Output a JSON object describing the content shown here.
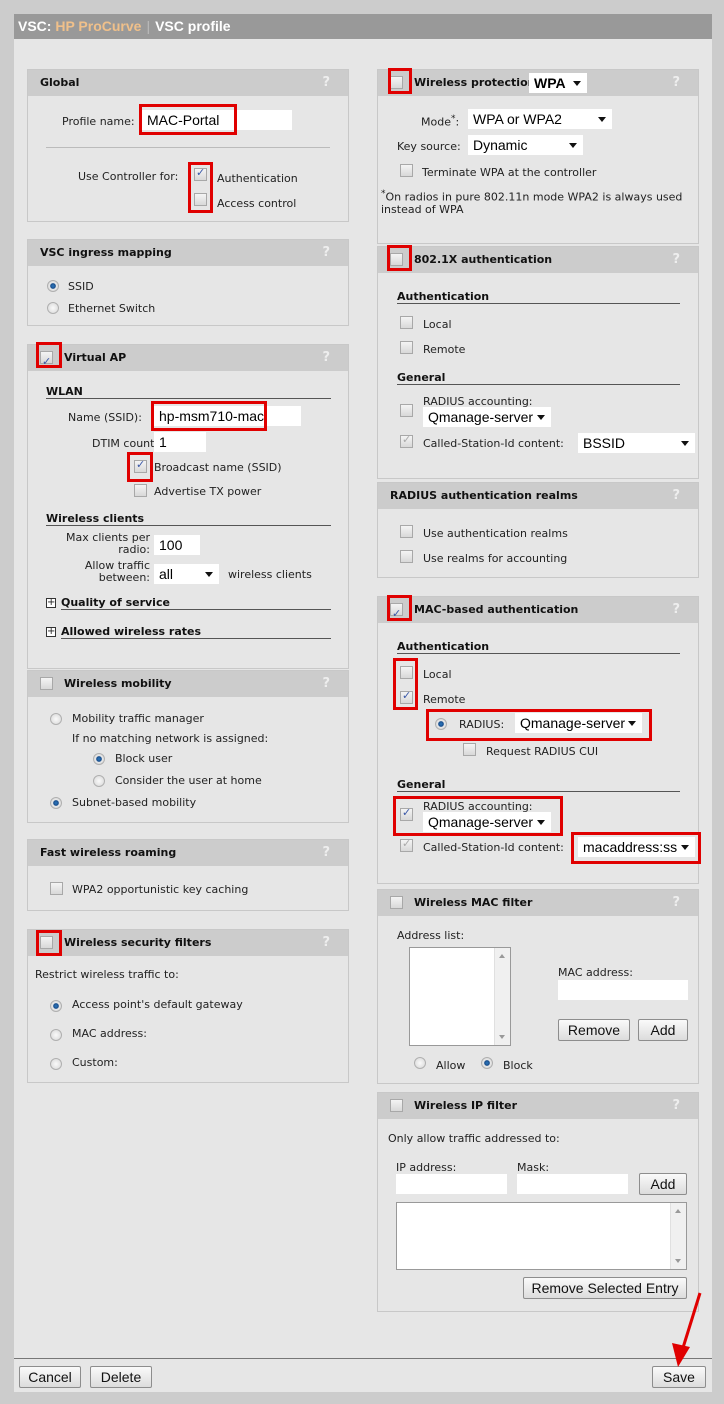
{
  "title": {
    "prefix": "VSC:",
    "brand": "HP ProCurve",
    "separator": "|",
    "page": "VSC profile"
  },
  "global": {
    "header": "Global",
    "help": "?",
    "profile_name_label": "Profile name:",
    "profile_name_value": "MAC-Portal",
    "use_controller_label": "Use Controller for:",
    "authentication_label": "Authentication",
    "authentication_checked": true,
    "access_control_label": "Access control",
    "access_control_checked": false
  },
  "ingress": {
    "header": "VSC ingress mapping",
    "help": "?",
    "options": [
      "SSID",
      "Ethernet Switch"
    ],
    "selected": "SSID"
  },
  "virtual_ap": {
    "header": "Virtual AP",
    "help": "?",
    "enabled": true,
    "wlan_section": "WLAN",
    "ssid_label": "Name (SSID):",
    "ssid_value": "hp-msm710-mac",
    "dtim_label": "DTIM count:",
    "dtim_value": "1",
    "broadcast_label": "Broadcast name (SSID)",
    "broadcast_checked": true,
    "advertise_label": "Advertise TX power",
    "advertise_checked": false,
    "clients_section": "Wireless clients",
    "max_clients_label_1": "Max clients per",
    "max_clients_label_2": "radio:",
    "max_clients_value": "100",
    "allow_traffic_label_1": "Allow traffic",
    "allow_traffic_label_2": "between:",
    "allow_traffic_value": "all",
    "allow_traffic_suffix": "wireless clients",
    "qos_label": "Quality of service",
    "rates_label": "Allowed wireless rates",
    "expand_symbol": "+"
  },
  "mobility": {
    "header": "Wireless mobility",
    "help": "?",
    "enabled": false,
    "traffic_manager_label": "Mobility traffic manager",
    "no_match_label": "If no matching network is assigned:",
    "block_user_label": "Block user",
    "consider_home_label": "Consider the user at home",
    "subnet_label": "Subnet-based mobility"
  },
  "roaming": {
    "header": "Fast wireless roaming",
    "help": "?",
    "okc_label": "WPA2 opportunistic key caching",
    "okc_checked": false
  },
  "security_filters": {
    "header": "Wireless security filters",
    "help": "?",
    "enabled": false,
    "restrict_label": "Restrict wireless traffic to:",
    "options": [
      "Access point's default gateway",
      "MAC address:",
      "Custom:"
    ],
    "selected": "Access point's default gateway"
  },
  "protection": {
    "header": "Wireless protection",
    "help": "?",
    "enabled": false,
    "type_value": "WPA",
    "mode_label": "Mode",
    "mode_asterisk": "*",
    "mode_colon": ":",
    "mode_value": "WPA or WPA2",
    "key_source_label": "Key source:",
    "key_source_value": "Dynamic",
    "terminate_label": "Terminate WPA at the controller",
    "terminate_checked": false,
    "note_asterisk": "*",
    "note": "On radios in pure 802.11n mode WPA2 is always used instead of WPA"
  },
  "dot1x": {
    "header": "802.1X authentication",
    "help": "?",
    "enabled": false,
    "auth_section": "Authentication",
    "local_label": "Local",
    "remote_label": "Remote",
    "general_section": "General",
    "radius_accounting_label": "RADIUS accounting:",
    "radius_accounting_value": "Qmanage-server",
    "called_station_label": "Called-Station-Id content:",
    "called_station_value": "BSSID"
  },
  "realms": {
    "header": "RADIUS authentication realms",
    "help": "?",
    "use_realms_label": "Use authentication realms",
    "realms_accounting_label": "Use realms for accounting"
  },
  "mac_auth": {
    "header": "MAC-based authentication",
    "help": "?",
    "enabled": true,
    "auth_section": "Authentication",
    "local_label": "Local",
    "local_checked": false,
    "remote_label": "Remote",
    "remote_checked": true,
    "radius_label": "RADIUS:",
    "radius_value": "Qmanage-server",
    "cui_label": "Request RADIUS CUI",
    "general_section": "General",
    "radius_accounting_label": "RADIUS accounting:",
    "radius_accounting_value": "Qmanage-server",
    "radius_accounting_checked": true,
    "called_station_label": "Called-Station-Id content:",
    "called_station_value": "macaddress:ss"
  },
  "mac_filter": {
    "header": "Wireless MAC filter",
    "help": "?",
    "enabled": false,
    "address_list_label": "Address list:",
    "mac_address_label": "MAC address:",
    "mac_address_value": "",
    "remove_label": "Remove",
    "add_label": "Add",
    "allow_label": "Allow",
    "block_label": "Block",
    "selected": "Block"
  },
  "ip_filter": {
    "header": "Wireless IP filter",
    "help": "?",
    "enabled": false,
    "only_allow_label": "Only allow traffic addressed to:",
    "ip_label": "IP address:",
    "mask_label": "Mask:",
    "ip_value": "",
    "mask_value": "",
    "add_label": "Add",
    "remove_selected_label": "Remove Selected Entry"
  },
  "footer": {
    "cancel": "Cancel",
    "delete": "Delete",
    "save": "Save"
  },
  "colors": {
    "highlight": "#e00000",
    "brand": "#f0c08a",
    "titlebar": "#999999"
  }
}
